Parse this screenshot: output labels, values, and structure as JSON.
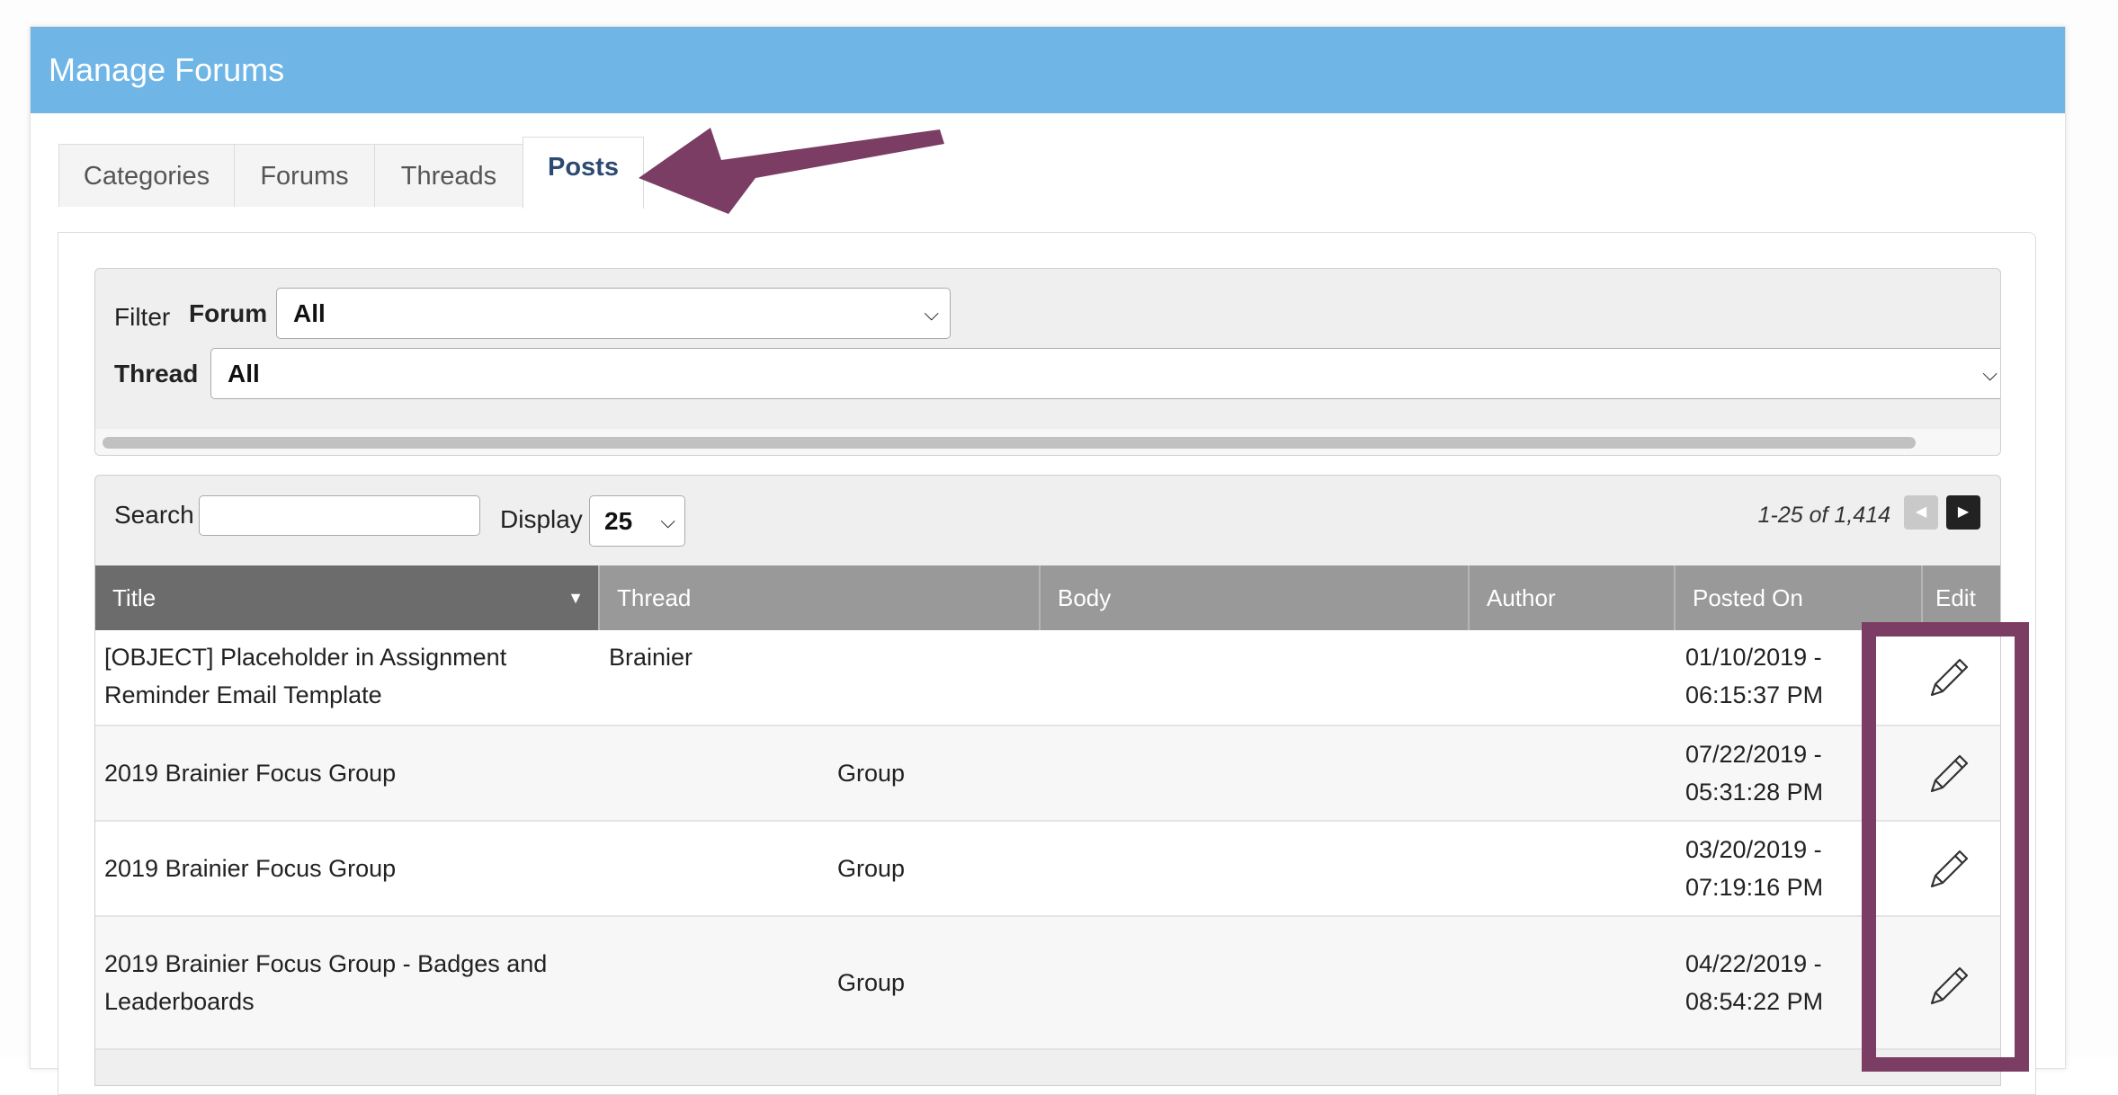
{
  "header": {
    "title": "Manage Forums"
  },
  "tabs": [
    {
      "label": "Categories"
    },
    {
      "label": "Forums"
    },
    {
      "label": "Threads"
    },
    {
      "label": "Posts",
      "active": true
    }
  ],
  "filter": {
    "label": "Filter",
    "forum_label": "Forum",
    "forum_value": "All",
    "thread_label": "Thread",
    "thread_value": "All"
  },
  "toolbar": {
    "search_label": "Search",
    "search_value": "",
    "display_label": "Display",
    "display_value": "25",
    "pager_text": "1-25 of 1,414"
  },
  "table": {
    "columns": [
      "Title",
      "Thread",
      "Body",
      "Author",
      "Posted On",
      "Edit"
    ],
    "rows": [
      {
        "title": "[OBJECT] Placeholder in Assignment Reminder Email Template",
        "thread": "Brainier",
        "body": "",
        "author": "",
        "posted_on": "01/10/2019 - 06:15:37 PM"
      },
      {
        "title": "2019 Brainier Focus Group",
        "thread": "Group",
        "body": "",
        "author": "",
        "posted_on": "07/22/2019 - 05:31:28 PM"
      },
      {
        "title": "2019 Brainier Focus Group",
        "thread": "Group",
        "body": "",
        "author": "",
        "posted_on": "03/20/2019 - 07:19:16 PM"
      },
      {
        "title": "2019 Brainier Focus Group - Badges and Leaderboards",
        "thread": "Group",
        "body": "",
        "author": "",
        "posted_on": "04/22/2019 - 08:54:22 PM"
      }
    ]
  },
  "colors": {
    "header_bg": "#6fb6e6",
    "active_tab_text": "#2c4a72",
    "annotation": "#7b3d63",
    "sorted_header_bg": "#6c6c6c",
    "header_bg_col": "#999999"
  },
  "icons": {
    "edit": "pencil-icon",
    "sort": "sort-down-icon",
    "prev": "prev-page-icon",
    "next": "next-page-icon"
  }
}
